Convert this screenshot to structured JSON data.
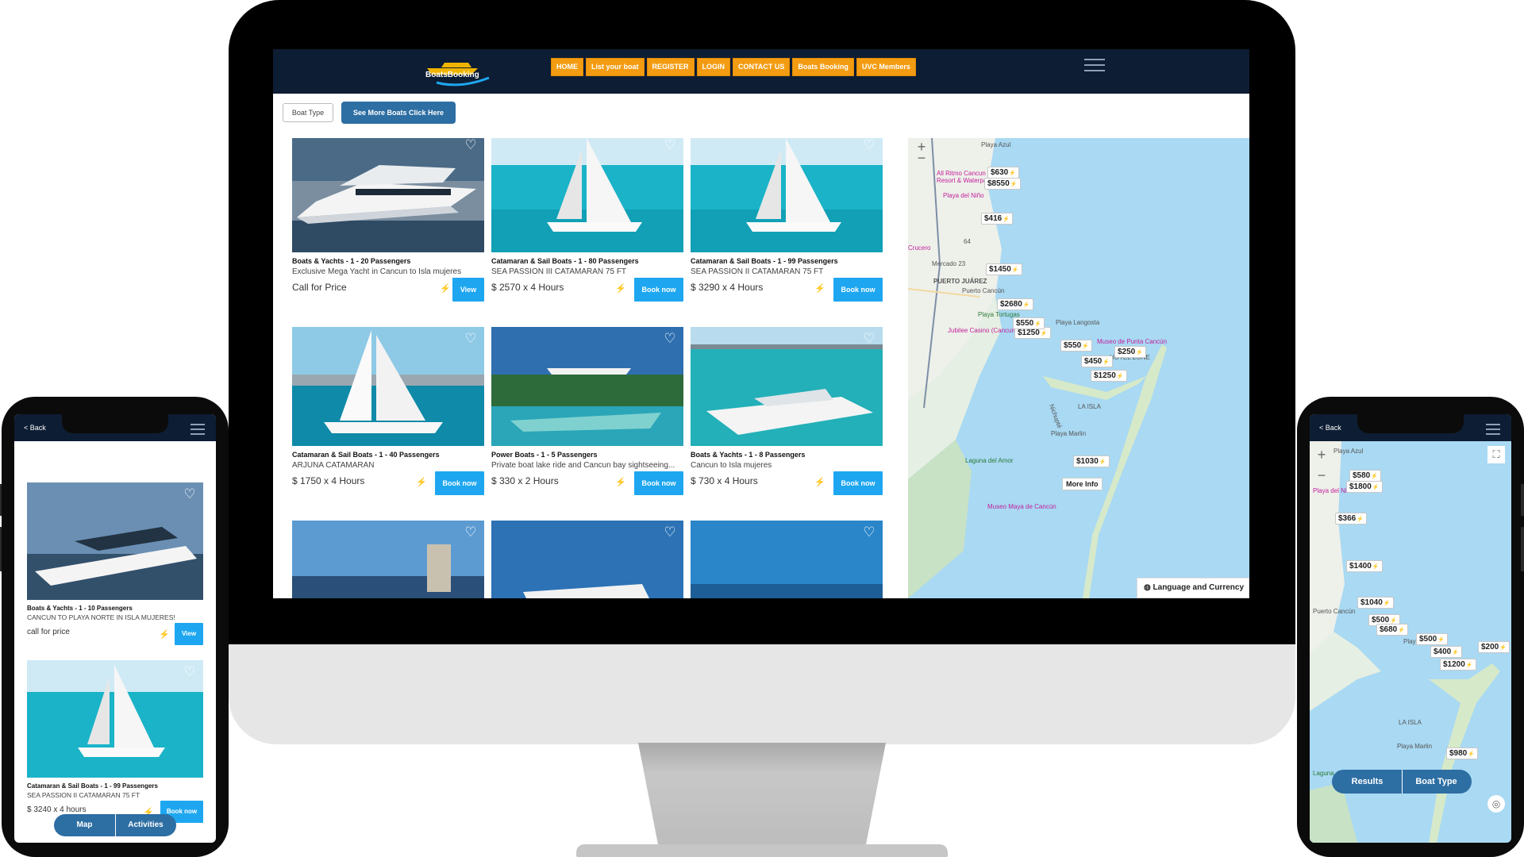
{
  "desktop": {
    "nav": {
      "logo_text": "BoatsBooking",
      "buttons": [
        "HOME",
        "List your boat",
        "REGISTER",
        "LOGIN",
        "CONTACT US",
        "Boats Booking",
        "UVC Members"
      ]
    },
    "filter": {
      "boat_type": "Boat Type",
      "see_more": "See More Boats Click Here"
    },
    "cards": [
      {
        "category": "Boats & Yachts - 1 - 20 Passengers",
        "name": "Exclusive Mega Yacht in Cancun to Isla mujeres",
        "price": "Call for Price",
        "button": "View"
      },
      {
        "category": "Catamaran & Sail Boats - 1 - 80 Passengers",
        "name": "SEA PASSION III CATAMARAN 75 FT",
        "price": "$ 2570 x 4 Hours",
        "button": "Book now"
      },
      {
        "category": "Catamaran & Sail Boats - 1 - 99 Passengers",
        "name": "SEA PASSION II CATAMARAN 75 FT",
        "price": "$ 3290 x 4 Hours",
        "button": "Book now"
      },
      {
        "category": "Catamaran & Sail Boats - 1 - 40 Passengers",
        "name": "ARJUNA CATAMARAN",
        "price": "$ 1750 x 4 Hours",
        "button": "Book now"
      },
      {
        "category": "Power Boats - 1 - 5 Passengers",
        "name": "Private boat lake ride and Cancun bay sightseeing...",
        "price": "$ 330 x 2 Hours",
        "button": "Book now"
      },
      {
        "category": "Boats & Yachts - 1 - 8 Passengers",
        "name": "Cancun to Isla mujeres",
        "price": "$ 730 x 4 Hours",
        "button": "Book now"
      }
    ],
    "map": {
      "pins": [
        "$630",
        "$8550",
        "$416",
        "$1450",
        "$2680",
        "$1250",
        "$550",
        "$550",
        "$250",
        "$450",
        "$1250",
        "$1030"
      ],
      "labels": [
        "Playa Azul",
        "All Ritmo Cancun Resort & Waterpark",
        "Playa del Niño",
        "Crucero",
        "Mercado 23",
        "PUERTO JUÁREZ",
        "Puerto Cancún",
        "Playa Tortugas",
        "Jubilee Casino (Cancun)",
        "Playa Langosta",
        "Museo de Punta Cancún",
        "HOTEL ZONE",
        "LA ISLA",
        "Playa Marlin",
        "Laguna del Amor",
        "Nichupté",
        "Museo Maya de Cancún",
        "64"
      ],
      "more_info": "More Info",
      "language": "Language and Currency",
      "zoom_in": "+",
      "zoom_out": "−"
    }
  },
  "phone_left": {
    "back": "< Back",
    "cards": [
      {
        "category": "Boats & Yachts - 1 - 10 Passengers",
        "name": "CANCUN TO PLAYA NORTE IN ISLA MUJERES!",
        "price": "call for price",
        "button": "View"
      },
      {
        "category": "Catamaran & Sail Boats - 1 - 99 Passengers",
        "name": "SEA PASSION II CATAMARAN 75 FT",
        "price": "$ 3240 x 4 hours",
        "button": "Book now"
      }
    ],
    "tabs": [
      "Map",
      "Activities"
    ]
  },
  "phone_right": {
    "back": "< Back",
    "pins": [
      "$580",
      "$1800",
      "$366",
      "$1400",
      "$1040",
      "$500",
      "$680",
      "$500",
      "$400",
      "$200",
      "$1200",
      "$980"
    ],
    "labels": [
      "Playa Azul",
      "Playa del Niño",
      "Puerto Cancún",
      "Playa Langosta",
      "LA ISLA",
      "Playa Marlin",
      "Laguna del Amor"
    ],
    "tabs": [
      "Results",
      "Boat Type"
    ]
  },
  "colors": {
    "navbar": "#0d1d33",
    "nav_button": "#f39c12",
    "book_button": "#1ea7f0",
    "primary_blue": "#2d6ea3",
    "water": "#a9d9f3"
  }
}
